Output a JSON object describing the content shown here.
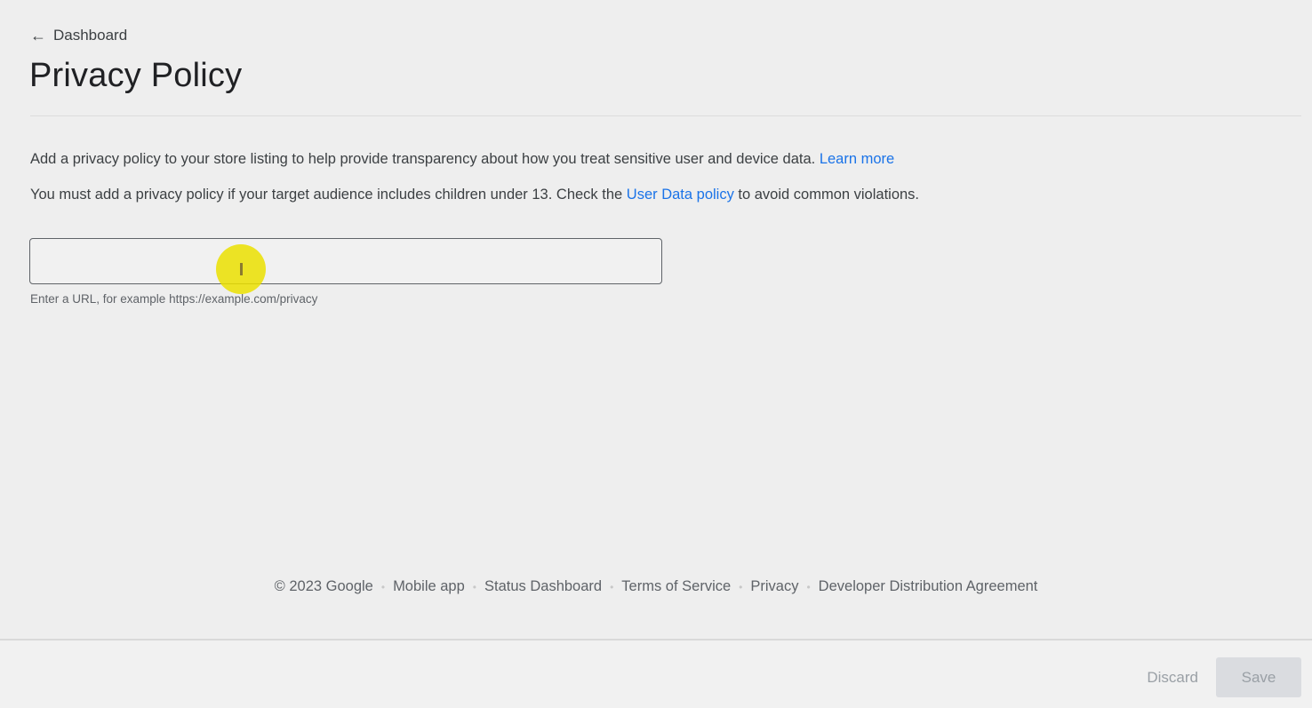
{
  "breadcrumb": {
    "back_icon": "arrow-left-icon",
    "label": "Dashboard"
  },
  "page": {
    "title": "Privacy Policy"
  },
  "description": {
    "line1_text": "Add a privacy policy to your store listing to help provide transparency about how you treat sensitive user and device data. ",
    "line1_link": "Learn more",
    "line2_text_before": "You must add a privacy policy if your target audience includes children under 13. Check the ",
    "line2_link": "User Data policy",
    "line2_text_after": " to avoid common violations."
  },
  "url_field": {
    "value": "",
    "placeholder": "",
    "helper_text": "Enter a URL, for example https://example.com/privacy"
  },
  "footer": {
    "copyright": "© 2023 Google",
    "links": [
      "Mobile app",
      "Status Dashboard",
      "Terms of Service",
      "Privacy",
      "Developer Distribution Agreement"
    ]
  },
  "actions": {
    "discard_label": "Discard",
    "save_label": "Save"
  },
  "colors": {
    "background": "#eeeeee",
    "link": "#1a73e8",
    "cursor_highlight": "#ebe100"
  }
}
